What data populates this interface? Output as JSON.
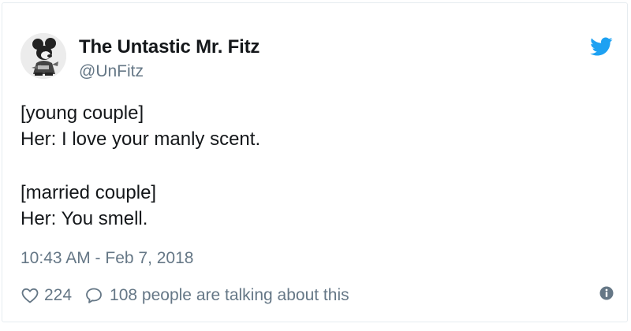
{
  "author": {
    "display_name": "The Untastic Mr. Fitz",
    "handle": "@UnFitz",
    "avatar_icon": "cartoon-mouse-avatar-icon"
  },
  "brand": {
    "icon": "twitter-bird-icon",
    "color": "#1da1f2"
  },
  "tweet": {
    "lines": [
      "[young couple]",
      "Her: I love your manly scent.",
      "[married couple]",
      "Her: You smell."
    ],
    "timestamp": "10:43 AM - Feb 7, 2018"
  },
  "actions": {
    "like_icon": "heart-outline-icon",
    "like_count": "224",
    "reply_icon": "speech-bubble-icon",
    "talking_label": "108 people are talking about this",
    "info_icon": "info-icon"
  },
  "colors": {
    "text_primary": "#14171a",
    "text_secondary": "#657786",
    "border": "#e6ecf0"
  }
}
